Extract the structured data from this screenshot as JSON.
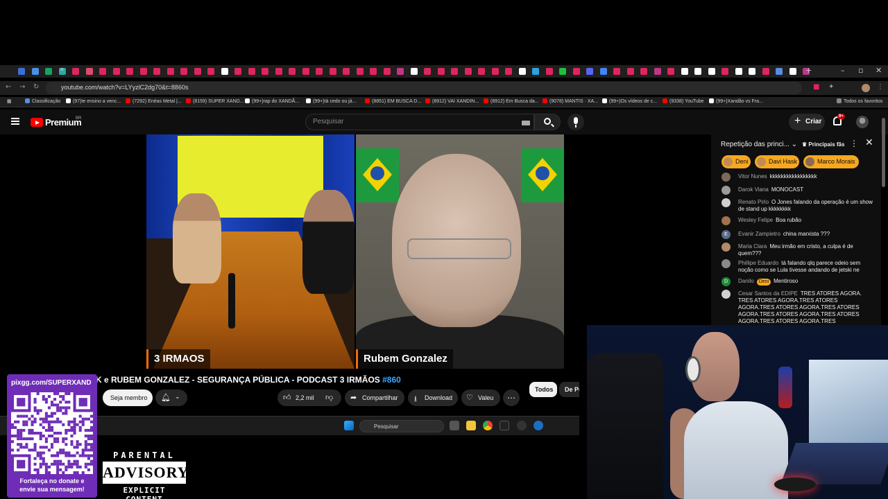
{
  "browser": {
    "url": "youtube.com/watch?v=LYyzlC2dg70&t=8860s",
    "accent_colors": {
      "red_tab": "#e0245e",
      "chrome_bg": "#1f1f1f"
    },
    "bookmarks": [
      {
        "label": "Classificação",
        "icon": "globe-icon",
        "color": "#5a8de0"
      },
      {
        "label": "(97)te ensino a venc...",
        "icon": "tiktok-icon",
        "color": "#ffffff"
      },
      {
        "label": "(7292) Enéas Metal |...",
        "icon": "youtube-icon",
        "color": "#ff0000"
      },
      {
        "label": "(8159) SUPER XAND...",
        "icon": "youtube-icon",
        "color": "#ff0000"
      },
      {
        "label": "(99+)rap do XANDÃ...",
        "icon": "tiktok-icon",
        "color": "#ffffff"
      },
      {
        "label": "(99+)tá cedo ou já...",
        "icon": "tiktok-icon",
        "color": "#ffffff"
      },
      {
        "label": "(8851) EM BUSCA D...",
        "icon": "youtube-icon",
        "color": "#ff0000"
      },
      {
        "label": "(8912) VAI XANDIN...",
        "icon": "youtube-icon",
        "color": "#ff0000"
      },
      {
        "label": "(8912) Em Busca da...",
        "icon": "youtube-icon",
        "color": "#ff0000"
      },
      {
        "label": "(9078) MANTIS · XA...",
        "icon": "youtube-icon",
        "color": "#ff0000"
      },
      {
        "label": "(99+)Os vídeos de c...",
        "icon": "tiktok-icon",
        "color": "#ffffff"
      },
      {
        "label": "(9338) YouTube",
        "icon": "youtube-icon",
        "color": "#ff0000"
      },
      {
        "label": "(99+)Xandão vs Fra...",
        "icon": "tiktok-icon",
        "color": "#ffffff"
      }
    ],
    "all_favorites": "Todos os favoritos"
  },
  "youtube": {
    "brand": "Premium",
    "country": "BR",
    "search_placeholder": "Pesquisar",
    "create_label": "Criar",
    "notif_badge": "9+",
    "video": {
      "left_label": "3 IRMAOS",
      "right_label": "Rubem Gonzalez",
      "title": "K e RUBEM GONZALEZ - SEGURANÇA PÚBLICA - PODCAST 3 IRMÃOS ",
      "title_number": "#860"
    },
    "actions": {
      "join": "Seja membro",
      "likes": "2,2 mil",
      "share": "Compartilhar",
      "download": "Download",
      "thanks": "Valeu",
      "more": "⋯"
    },
    "chips": [
      "Todos",
      "De Po"
    ]
  },
  "chat": {
    "header": "Repetição das princi...",
    "top_fans": "Principais fãs",
    "donors": [
      "Deni",
      "Davi Hask",
      "Marco Morais"
    ],
    "messages": [
      {
        "name": "Vitor Nunes",
        "text": "kkkkkkkkkkkkkkkkk",
        "color": "#7a6a5a"
      },
      {
        "name": "Darok Viana",
        "text": "MONOCAST",
        "color": "#9a9a9a"
      },
      {
        "name": "Renato Pirlo",
        "text": "O Jones falando da operação é um show de stand up kkkkkkkk",
        "color": "#cfcfcf"
      },
      {
        "name": "Wesley Felipe",
        "text": "Boa rubão",
        "color": "#a0724f"
      },
      {
        "name": "Evanir Zampietro",
        "text": "china marxista ???",
        "color": "#5b6b8a",
        "initial": "E"
      },
      {
        "name": "Maria Clara",
        "text": "Meu irmão em cristo, a culpa é de quem???",
        "color": "#b08a6a"
      },
      {
        "name": "Phillipe Eduardo",
        "text": "tá falando qlq parece odeio sem noção como se Lula tivesse andando de jetski ne",
        "color": "#8a8a8a"
      },
      {
        "name": "Danilo",
        "badge": "Deni",
        "text": "Mentiroso",
        "color": "#1f8a3a",
        "initial": "D"
      },
      {
        "name": "Cesar Santos da EDIPE",
        "text": "TRES ATORES AGORA. TRES ATORES AGORA.TRES ATORES AGORA.TRES ATORES AGORA.TRES ATORES AGORA.TRES ATORES AGORA.TRES ATORES AGORA.TRES ATORES AGORA.TRES",
        "color": "#d0d0d0"
      }
    ]
  },
  "overlay": {
    "qr_url": "pixgg.com/SUPERXAND",
    "qr_caption_1": "Fortaleça no donate e",
    "qr_caption_2": "envie sua mensagem!",
    "qr_bg": "#6f2db7",
    "advisory_top": "PARENTAL",
    "advisory_mid": "ADVISORY",
    "advisory_bot": "EXPLICIT CONTENT"
  },
  "taskbar": {
    "search_placeholder": "Pesquisar"
  }
}
